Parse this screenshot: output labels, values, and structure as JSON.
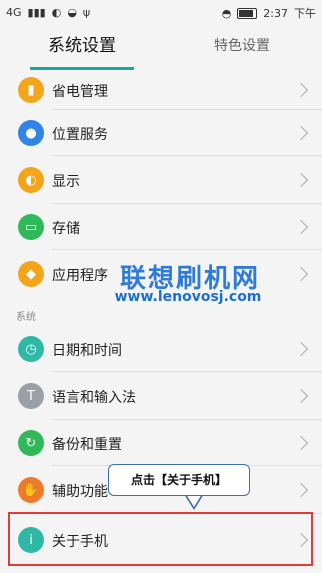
{
  "status_bar": {
    "left_text": "4G",
    "time": "2:37",
    "ampm": "下午"
  },
  "tabs": [
    {
      "label": "系统设置",
      "active": true
    },
    {
      "label": "特色设置",
      "active": false
    }
  ],
  "items": [
    {
      "label": "省电管理",
      "icon": "battery-icon",
      "color": "#f2a41b"
    },
    {
      "label": "位置服务",
      "icon": "location-icon",
      "color": "#2f86e6"
    },
    {
      "label": "显示",
      "icon": "brightness-icon",
      "color": "#f2a41b"
    },
    {
      "label": "存储",
      "icon": "storage-icon",
      "color": "#2fb95a"
    },
    {
      "label": "应用程序",
      "icon": "android-icon",
      "color": "#f2a41b"
    }
  ],
  "section_label": "系统",
  "system_items": [
    {
      "label": "日期和时间",
      "icon": "clock-icon",
      "color": "#2fb8a6"
    },
    {
      "label": "语言和输入法",
      "icon": "text-icon",
      "color": "#9aa0a6"
    },
    {
      "label": "备份和重置",
      "icon": "refresh-icon",
      "color": "#2fb95a"
    },
    {
      "label": "辅助功能",
      "icon": "hand-icon",
      "color": "#f07a2b"
    },
    {
      "label": "关于手机",
      "icon": "info-icon",
      "color": "#2fb8a6"
    }
  ],
  "watermark": {
    "title": "联想刷机网",
    "url": "www.lenovosj.com"
  },
  "callout": {
    "text": "点击【关于手机】"
  }
}
